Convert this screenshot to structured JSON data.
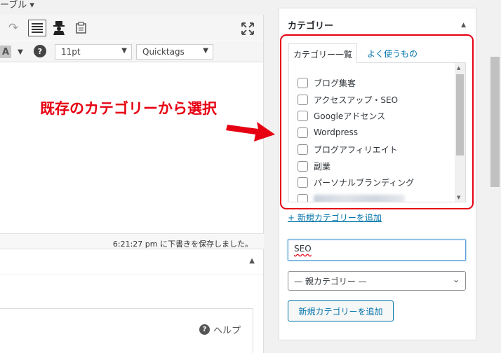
{
  "editor": {
    "top_label": "ーブル ▾",
    "font_size": "11pt",
    "format": "Quicktags",
    "text_color_letter": "A",
    "help_glyph": "?",
    "save_status": "6:21:27 pm に下書きを保存しました。",
    "help_label": "ヘルプ",
    "icons": [
      "redo-icon",
      "kitchen-sink-icon",
      "person-icon",
      "paste-icon",
      "fullscreen-icon",
      "text-color-icon",
      "help-icon"
    ]
  },
  "annotation": {
    "text": "既存のカテゴリーから選択",
    "color": "#e60012"
  },
  "category_panel": {
    "title": "カテゴリー",
    "tabs": [
      {
        "label": "カテゴリー一覧",
        "active": true
      },
      {
        "label": "よく使うもの",
        "active": false
      }
    ],
    "items": [
      {
        "label": "ブログ集客",
        "checked": false
      },
      {
        "label": "アクセスアップ・SEO",
        "checked": false
      },
      {
        "label": "Googleアドセンス",
        "checked": false
      },
      {
        "label": "Wordpress",
        "checked": false
      },
      {
        "label": "ブログアフィリエイト",
        "checked": false
      },
      {
        "label": "副業",
        "checked": false
      },
      {
        "label": "パーソナルブランディング",
        "checked": false
      },
      {
        "label": "",
        "checked": false,
        "blurred": true
      }
    ],
    "add_new_link": "+ 新規カテゴリーを追加",
    "new_category_value": "SEO",
    "parent_select": "— 親カテゴリー —",
    "add_button": "新規カテゴリーを追加"
  },
  "colors": {
    "link": "#0073aa",
    "highlight": "#e60012"
  }
}
